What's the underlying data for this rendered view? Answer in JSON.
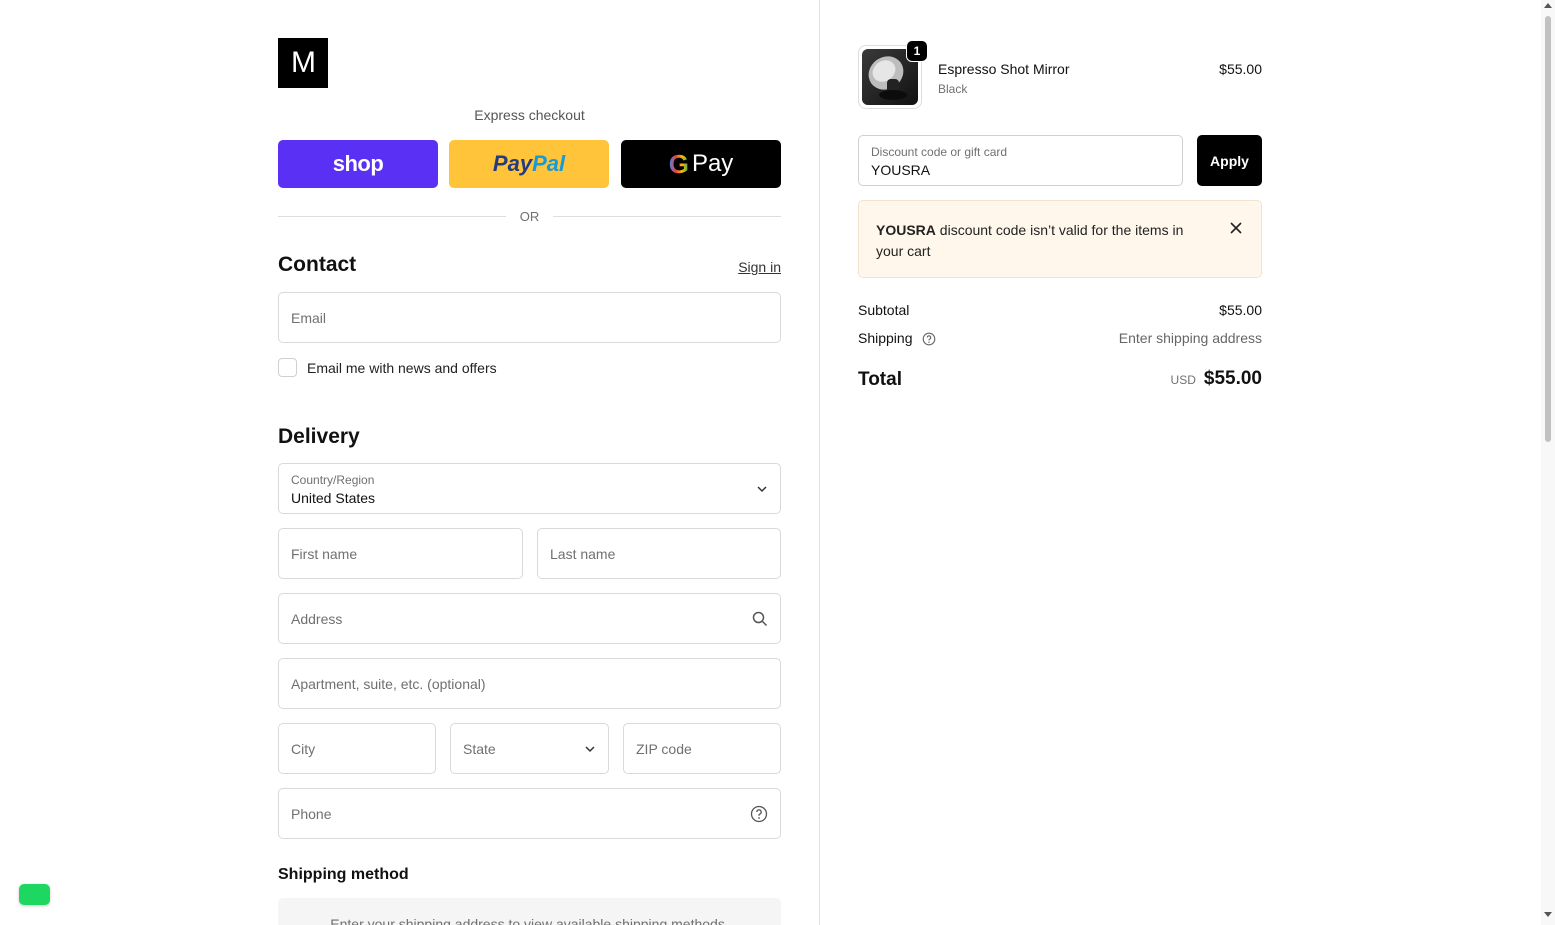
{
  "brand": {
    "logo_text": "M"
  },
  "express": {
    "label": "Express checkout",
    "shop_label": "shop",
    "paypal_label_1": "Pay",
    "paypal_label_2": "Pal",
    "gpay_g": "G",
    "gpay_label": "Pay",
    "or_label": "OR"
  },
  "contact": {
    "title": "Contact",
    "signin_label": "Sign in",
    "email_placeholder": "Email",
    "newsletter_label": "Email me with news and offers"
  },
  "delivery": {
    "title": "Delivery",
    "country_label": "Country/Region",
    "country_value": "United States",
    "first_name_placeholder": "First name",
    "last_name_placeholder": "Last name",
    "address_placeholder": "Address",
    "apartment_placeholder": "Apartment, suite, etc. (optional)",
    "city_placeholder": "City",
    "state_placeholder": "State",
    "zip_placeholder": "ZIP code",
    "phone_placeholder": "Phone"
  },
  "shipping_method": {
    "title": "Shipping method",
    "message": "Enter your shipping address to view available shipping methods."
  },
  "cart": {
    "item": {
      "quantity": "1",
      "name": "Espresso Shot Mirror",
      "variant": "Black",
      "price": "$55.00"
    },
    "discount": {
      "label": "Discount code or gift card",
      "value": "YOUSRA",
      "apply_label": "Apply"
    },
    "alert": {
      "code": "YOUSRA",
      "message": " discount code isn’t valid for the items in your cart"
    },
    "subtotal_label": "Subtotal",
    "subtotal_value": "$55.00",
    "shipping_label": "Shipping",
    "shipping_value": "Enter shipping address",
    "total_label": "Total",
    "currency": "USD",
    "total_value": "$55.00"
  },
  "colors": {
    "shop_purple": "#5a31f4",
    "paypal_yellow": "#ffc439",
    "alert_bg": "#fff7ec",
    "chat_green": "#1ed760"
  }
}
